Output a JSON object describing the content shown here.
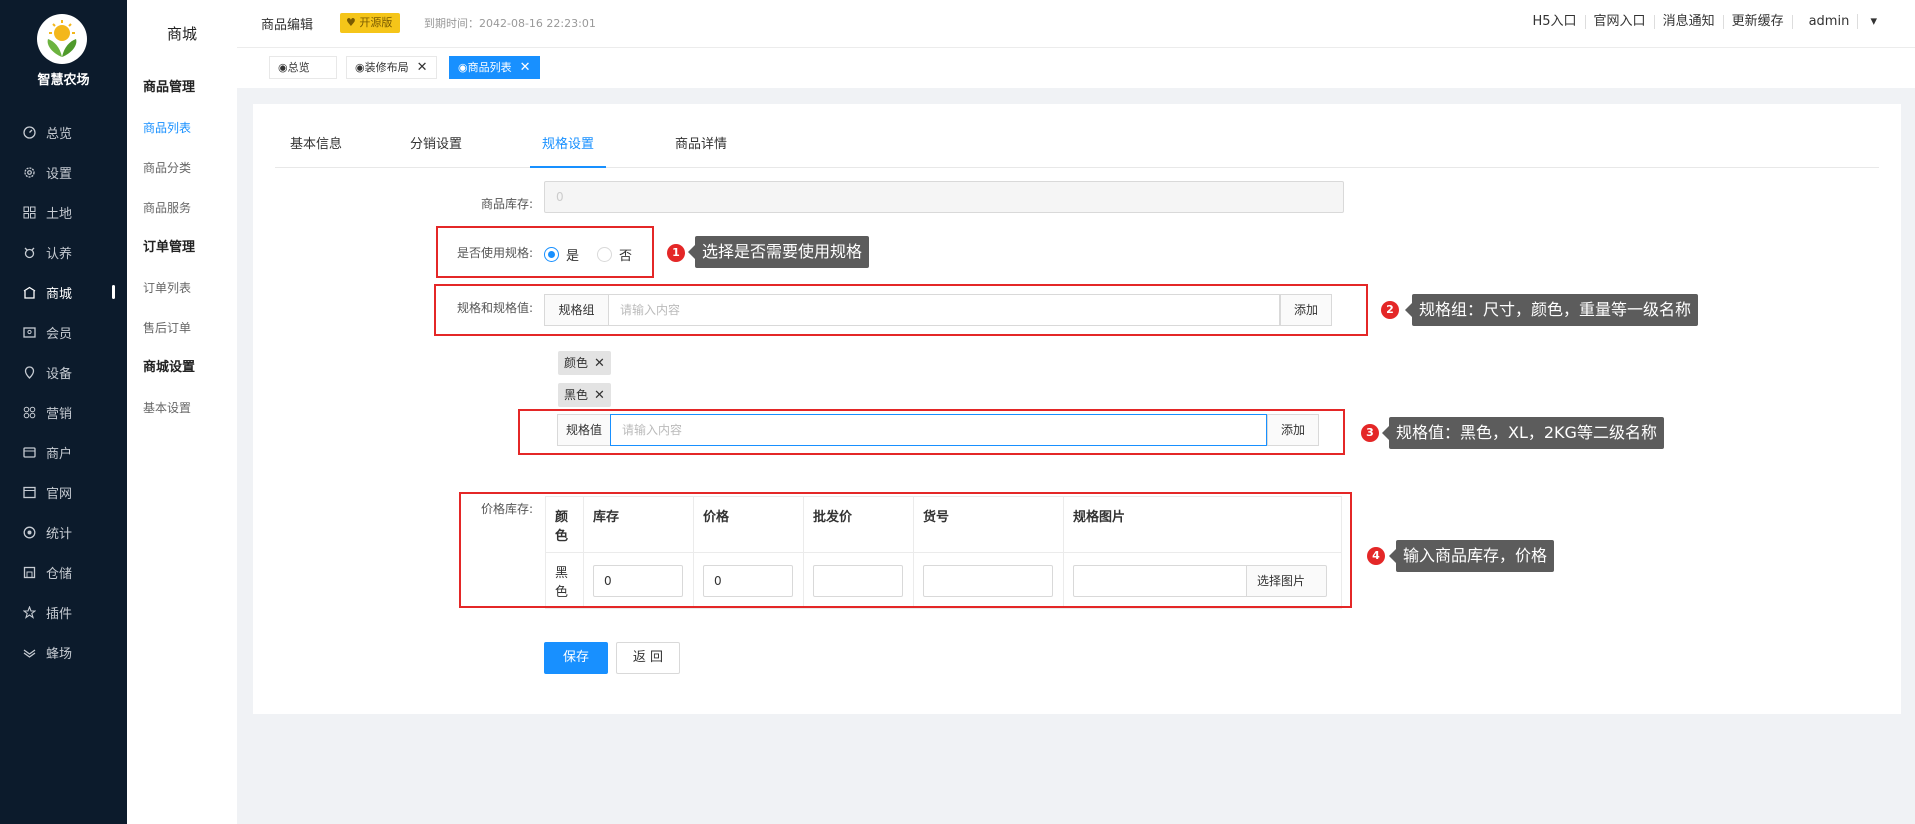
{
  "brand": {
    "name": "智慧农场"
  },
  "sidebar": {
    "items": [
      {
        "label": "总览",
        "icon": "dashboard-icon"
      },
      {
        "label": "设置",
        "icon": "gear-icon"
      },
      {
        "label": "土地",
        "icon": "grid-icon"
      },
      {
        "label": "认养",
        "icon": "adopt-icon"
      },
      {
        "label": "商城",
        "icon": "store-icon"
      },
      {
        "label": "会员",
        "icon": "member-icon"
      },
      {
        "label": "设备",
        "icon": "device-icon"
      },
      {
        "label": "营销",
        "icon": "marketing-icon"
      },
      {
        "label": "商户",
        "icon": "merchant-icon"
      },
      {
        "label": "官网",
        "icon": "website-icon"
      },
      {
        "label": "统计",
        "icon": "stats-icon"
      },
      {
        "label": "仓储",
        "icon": "warehouse-icon"
      },
      {
        "label": "插件",
        "icon": "star-icon"
      },
      {
        "label": "蜂场",
        "icon": "bee-icon"
      }
    ]
  },
  "subnav": {
    "title": "商城",
    "groups": [
      {
        "title": "商品管理",
        "items": [
          "商品列表",
          "商品分类",
          "商品服务"
        ]
      },
      {
        "title": "订单管理",
        "items": [
          "订单列表",
          "售后订单"
        ]
      },
      {
        "title": "商城设置",
        "items": [
          "基本设置"
        ]
      }
    ]
  },
  "topbar": {
    "title": "商品编辑",
    "badge": "开源版",
    "expire": "到期时间：2042-08-16 22:23:01",
    "links": [
      "H5入口",
      "官网入口",
      "消息通知",
      "更新缓存",
      "admin"
    ]
  },
  "tabs": [
    "◉总览",
    "◉装修布局",
    "◉商品列表"
  ],
  "form": {
    "tabs": [
      "基本信息",
      "分销设置",
      "规格设置",
      "商品详情"
    ],
    "stock_label": "商品库存:",
    "stock_value": "0",
    "use_spec_label": "是否使用规格:",
    "radio_yes": "是",
    "radio_no": "否",
    "spec_label": "规格和规格值:",
    "spec_group_addon": "规格组",
    "spec_group_placeholder": "请输入内容",
    "add_label": "添加",
    "chips": [
      "颜色",
      "黑色"
    ],
    "spec_value_addon": "规格值",
    "spec_value_placeholder": "请输入内容",
    "price_label": "价格库存:",
    "table": {
      "headers": [
        "颜色",
        "库存",
        "价格",
        "批发价",
        "货号",
        "规格图片"
      ],
      "row": {
        "color": "黑色",
        "stock": "0",
        "price": "0",
        "wholesale": "",
        "sku": "",
        "image_btn": "选择图片"
      }
    },
    "save": "保存",
    "back": "返 回"
  },
  "annotations": [
    {
      "num": "1",
      "text": "选择是否需要使用规格"
    },
    {
      "num": "2",
      "text": "规格组：尺寸，颜色，重量等一级名称"
    },
    {
      "num": "3",
      "text": "规格值：黑色，XL，2KG等二级名称"
    },
    {
      "num": "4",
      "text": "输入商品库存，价格"
    }
  ],
  "colors": {
    "primary": "#1890ff",
    "sidebar": "#0c1b2c",
    "annotation_red": "#e42727",
    "badge": "#f5c519"
  }
}
